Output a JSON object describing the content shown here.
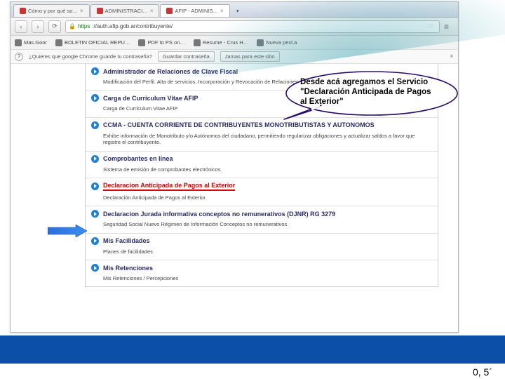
{
  "tabs": [
    {
      "label": "Cómo y por qué so…"
    },
    {
      "label": "ADMINISTRACI…"
    },
    {
      "label": "AFIP - ADMINIS…"
    }
  ],
  "url_prefix": "https",
  "url": "://auth.afip.gob.ar/contribuyente/",
  "bookmarks": [
    {
      "label": "Mas.Goor"
    },
    {
      "label": "BOLETIN OFICIAL REPU…"
    },
    {
      "label": "PDF to PS on…"
    },
    {
      "label": "Resume - Crus H…"
    },
    {
      "label": "Nueva pest.a"
    }
  ],
  "infobar": {
    "text": "¿Quieres que google Chrome guarde tu contraseña?",
    "btn_save": "Guardar contraseña",
    "btn_never": "Jamas para este sitio"
  },
  "sections": [
    {
      "title": "Administrador de Relaciones de Clave Fiscal",
      "desc": "Modificación del Perfil. Alta de servicios. Incorporación y Revocación de Relaciones"
    },
    {
      "title": "Carga de Curriculum Vitae AFIP",
      "desc": "Carga de Curriculum Vitae AFIP"
    },
    {
      "title": "CCMA - CUENTA CORRIENTE DE CONTRIBUYENTES MONOTRIBUTISTAS Y AUTONOMOS",
      "desc": "Exhibe información de Monotributo y/o Autónomos del ciudadano, permitiendo regularizar obligaciones y actualizar saldos a favor que registre el contribuyente."
    },
    {
      "title": "Comprobantes en línea",
      "desc": "Sistema de emisión de comprobantes electrónicos"
    },
    {
      "title": "Declaracion Anticipada de Pagos al Exterior",
      "desc": "Declaración Anticipada de Pagos al Exterior",
      "highlight": true
    },
    {
      "title": "Declaracion Jurada informativa conceptos no remunerativos (DJNR) RG 3279",
      "desc": "Seguridad Social Nuevo Régimen de Información Conceptos no remunerativos."
    },
    {
      "title": "Mis Facilidades",
      "desc": "Planes de facilidades"
    },
    {
      "title": "Mis Retenciones",
      "desc": "Mis Retenciones / Percepciones"
    }
  ],
  "callout_line1": "Desde acá agregamos el Servicio",
  "callout_line2": "\"Declaración Anticipada de Pagos",
  "callout_line3": "al Exterior\"",
  "timestamp": "0, 5´"
}
